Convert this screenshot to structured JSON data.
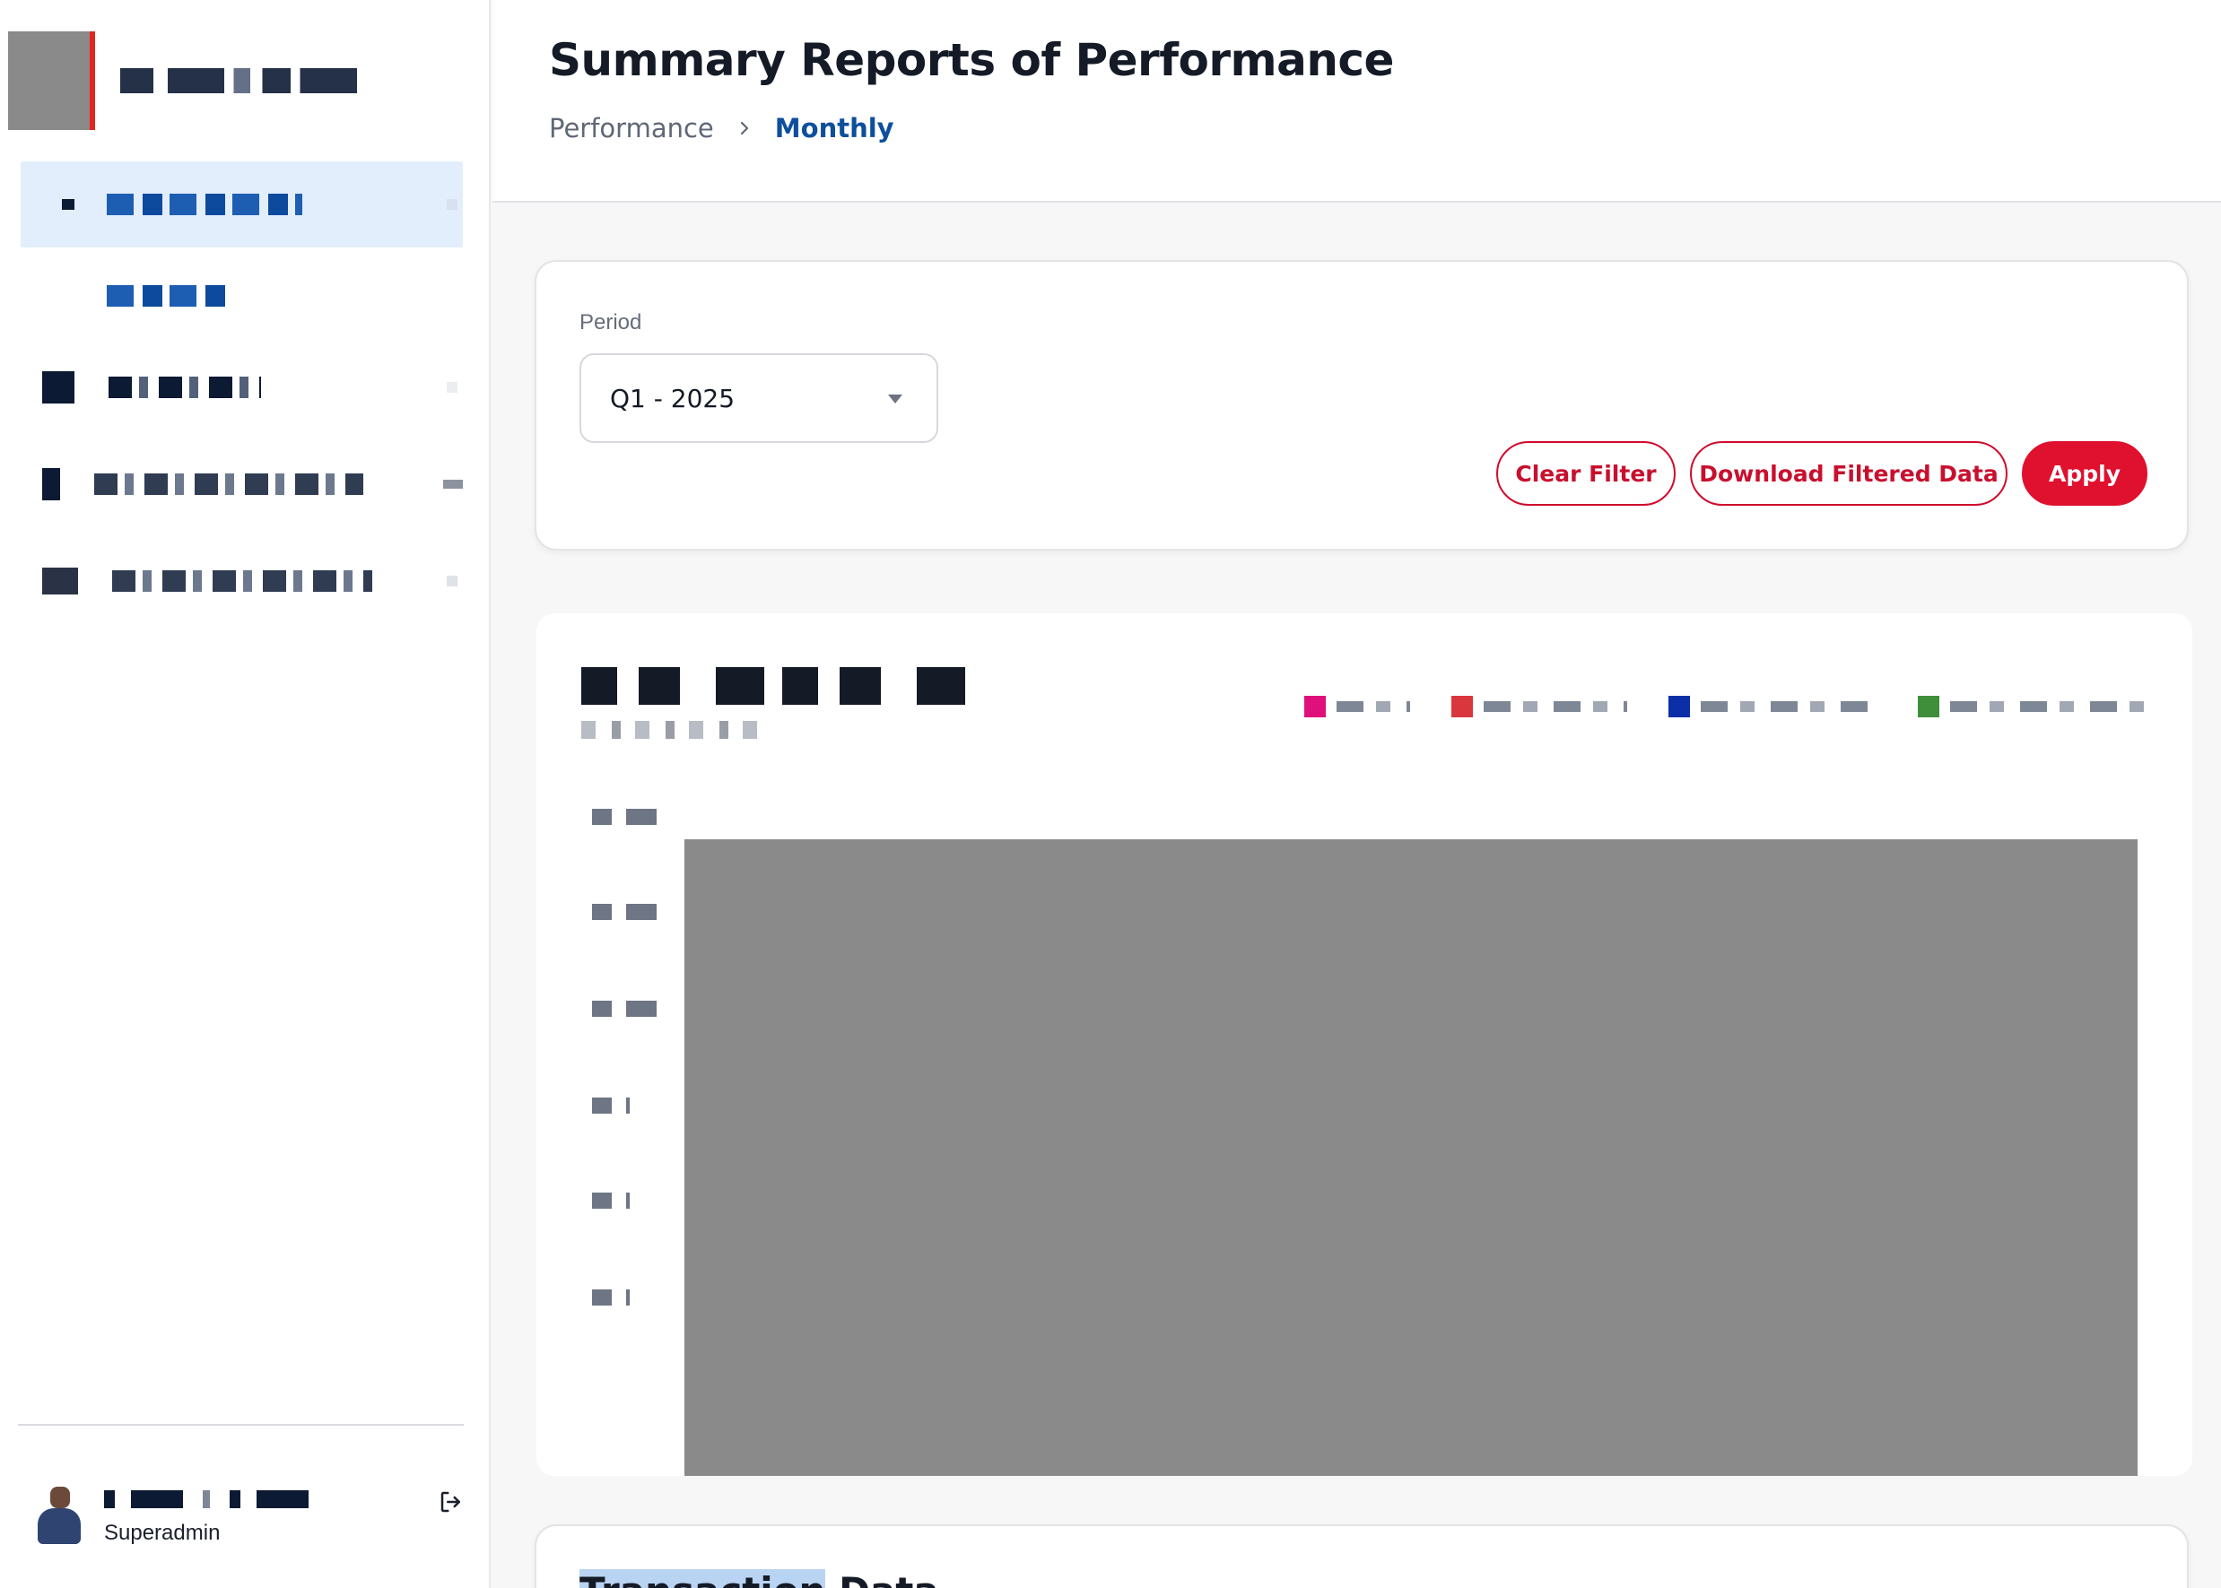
{
  "sidebar": {
    "nav": [
      {
        "name": "nav-item-1",
        "active": true
      },
      {
        "name": "nav-subitem-1",
        "active": false
      },
      {
        "name": "nav-item-2",
        "active": false
      },
      {
        "name": "nav-item-3",
        "active": false
      },
      {
        "name": "nav-item-4",
        "active": false
      }
    ],
    "user": {
      "role": "Superadmin"
    }
  },
  "header": {
    "title": "Summary Reports of Performance",
    "breadcrumb": {
      "parent": "Performance",
      "current": "Monthly"
    }
  },
  "filter": {
    "period_label": "Period",
    "period_value": "Q1 - 2025",
    "buttons": {
      "clear": "Clear Filter",
      "download": "Download Filtered Data",
      "apply": "Apply"
    }
  },
  "chart": {
    "legend_colors": [
      "#e0107a",
      "#d9363e",
      "#0c2fa8",
      "#3f8f3a"
    ]
  },
  "transactions": {
    "title_highlighted": "Transaction",
    "title_rest": " Data"
  },
  "colors": {
    "accent_red": "#e0102f",
    "accent_blue": "#0d4f9c",
    "active_nav_bg": "#e3eefc"
  }
}
